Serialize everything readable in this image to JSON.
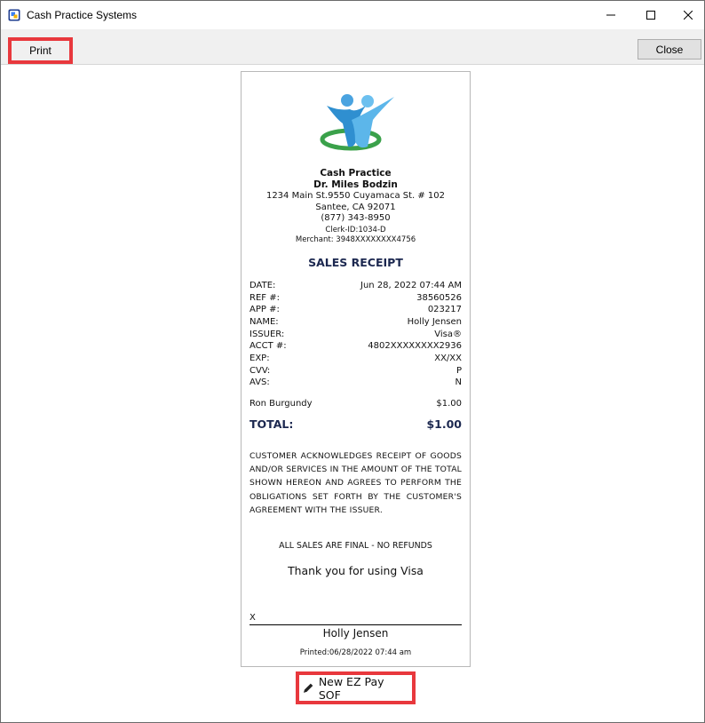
{
  "window": {
    "title": "Cash Practice Systems",
    "icons": [
      "app-icon",
      "minimize-icon",
      "maximize-icon",
      "close-icon"
    ]
  },
  "toolbar": {
    "print_label": "Print",
    "close_label": "Close"
  },
  "receipt": {
    "business_name": "Cash Practice",
    "doctor": "Dr. Miles Bodzin",
    "address": "1234 Main St.9550 Cuyamaca St. # 102",
    "city": "Santee, CA 92071",
    "phone": "(877) 343-8950",
    "clerk": "Clerk-ID:1034-D",
    "merchant": "Merchant: 3948XXXXXXXX4756",
    "title": "SALES RECEIPT",
    "fields": [
      {
        "label": "DATE:",
        "value": "Jun 28, 2022 07:44 AM"
      },
      {
        "label": "REF #:",
        "value": "38560526"
      },
      {
        "label": "APP #:",
        "value": "023217"
      },
      {
        "label": "NAME:",
        "value": "Holly Jensen"
      },
      {
        "label": "ISSUER:",
        "value": "Visa®"
      },
      {
        "label": "ACCT #:",
        "value": "4802XXXXXXXX2936"
      },
      {
        "label": "EXP:",
        "value": "XX/XX"
      },
      {
        "label": "CVV:",
        "value": "P"
      },
      {
        "label": "AVS:",
        "value": "N"
      }
    ],
    "line_item": {
      "name": "Ron Burgundy",
      "amount": "$1.00"
    },
    "total_label": "TOTAL:",
    "total_value": "$1.00",
    "acknowledgement": "CUSTOMER ACKNOWLEDGES RECEIPT OF GOODS AND/OR SERVICES IN THE AMOUNT OF THE TOTAL SHOWN HEREON AND AGREES TO PERFORM THE OBLIGATIONS SET FORTH BY THE CUSTOMER'S AGREEMENT WITH THE ISSUER.",
    "final_note": "ALL SALES ARE FINAL - NO REFUNDS",
    "thanks": "Thank you for using Visa",
    "signature_x": "X",
    "signature_name": "Holly Jensen",
    "printed": "Printed:06/28/2022 07:44 am"
  },
  "actions": {
    "new_ez_pay_label": "New EZ Pay SOF",
    "icon": "pencil-icon"
  },
  "colors": {
    "highlight": "#e8383d",
    "receipt_title": "#1c2850"
  }
}
